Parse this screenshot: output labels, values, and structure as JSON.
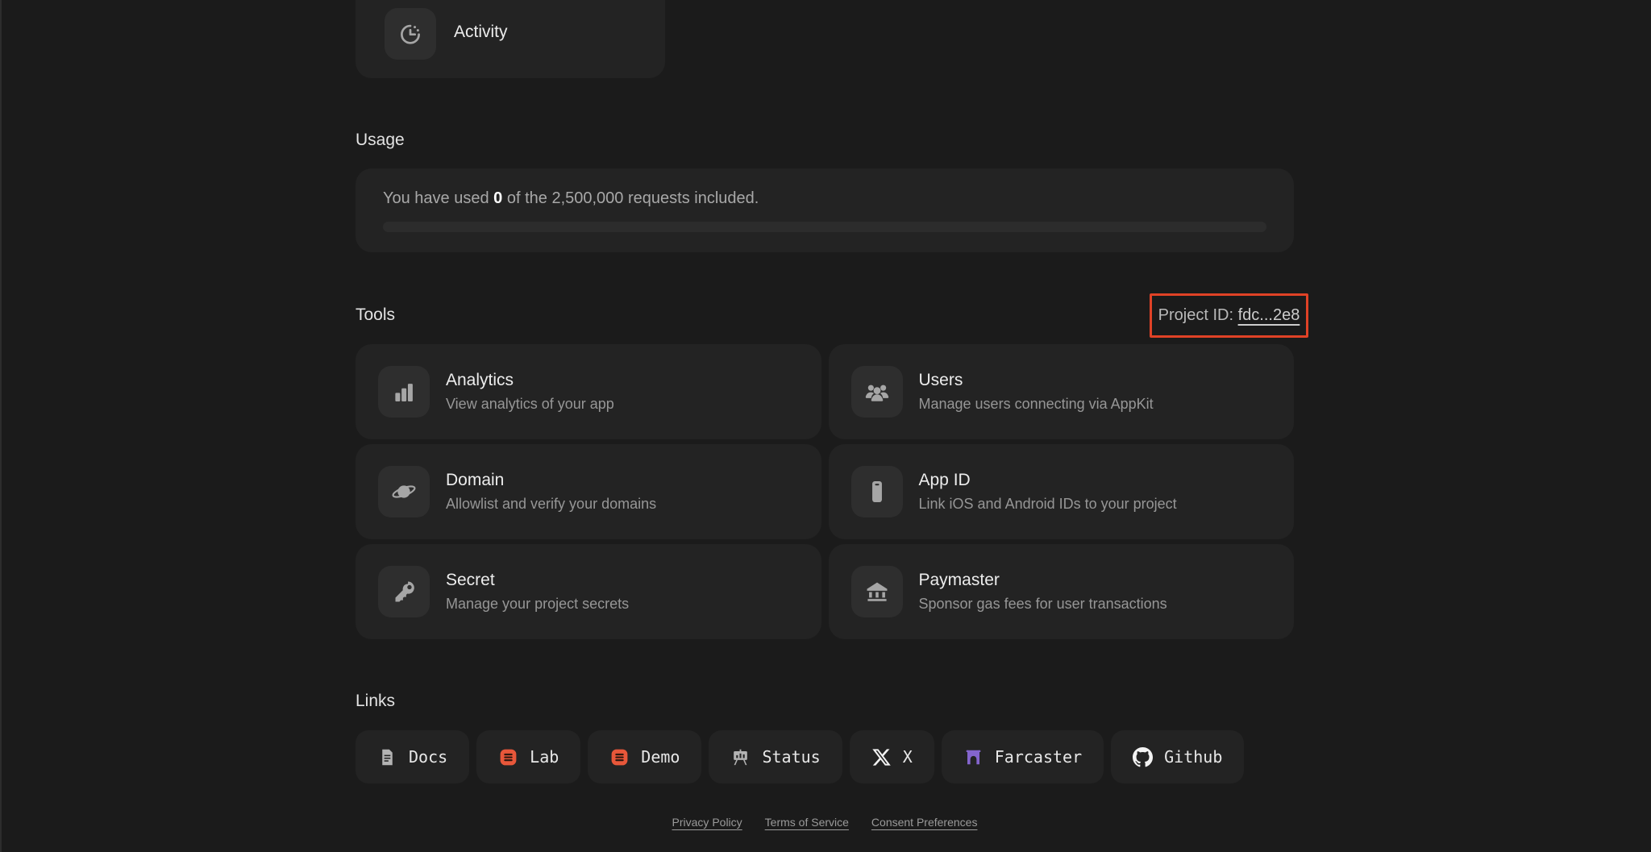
{
  "theme": {
    "background": "#1b1b1b",
    "card": "#232323",
    "icon_tile": "#2e2e2e",
    "icon_gray": "#a6a6a6",
    "highlight_border": "#e04226",
    "appkit_orange": "#e8573a",
    "farcaster_purple": "#8465cd",
    "title_color": "#ededed",
    "subtitle_color": "#969696"
  },
  "activity_card": {
    "label": "Activity",
    "icon": "activity-clock-icon"
  },
  "usage": {
    "heading": "Usage",
    "text_prefix": "You have used ",
    "used_value": "0",
    "text_suffix": " of the 2,500,000 requests included.",
    "progress_percent": 0
  },
  "tools": {
    "heading": "Tools",
    "project_id": {
      "label": "Project ID: ",
      "value": "fdc...2e8"
    },
    "cards": [
      {
        "title": "Analytics",
        "description": "View analytics of your app",
        "icon": "bar-chart-icon"
      },
      {
        "title": "Users",
        "description": "Manage users connecting via AppKit",
        "icon": "users-icon"
      },
      {
        "title": "Domain",
        "description": "Allowlist and verify your domains",
        "icon": "planet-icon"
      },
      {
        "title": "App ID",
        "description": "Link iOS and Android IDs to your project",
        "icon": "smartphone-icon"
      },
      {
        "title": "Secret",
        "description": "Manage your project secrets",
        "icon": "key-icon"
      },
      {
        "title": "Paymaster",
        "description": "Sponsor gas fees for user transactions",
        "icon": "bank-icon"
      }
    ]
  },
  "links": {
    "heading": "Links",
    "items": [
      {
        "label": "Docs",
        "icon": "docs-icon"
      },
      {
        "label": "Lab",
        "icon": "appkit-icon"
      },
      {
        "label": "Demo",
        "icon": "appkit-icon"
      },
      {
        "label": "Status",
        "icon": "status-board-icon"
      },
      {
        "label": "X",
        "icon": "x-logo-icon"
      },
      {
        "label": "Farcaster",
        "icon": "farcaster-icon"
      },
      {
        "label": "Github",
        "icon": "github-icon"
      }
    ]
  },
  "footer": {
    "links": [
      "Privacy Policy",
      "Terms of Service",
      "Consent Preferences"
    ]
  }
}
